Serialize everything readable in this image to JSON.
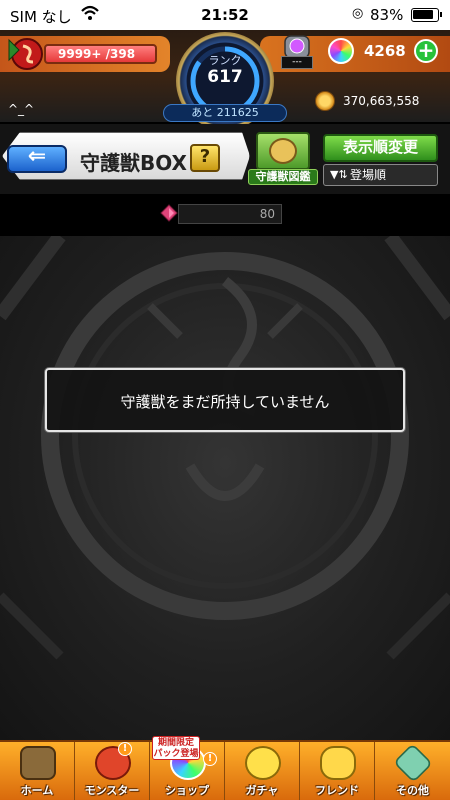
{
  "status_bar": {
    "carrier": "SIM なし",
    "time": "21:52",
    "battery_percent": "83%"
  },
  "header": {
    "stamina_current": "9999+",
    "stamina_max": "/398",
    "stamina_fill": 1.0,
    "rank_label": "ランク",
    "rank_value": "617",
    "rank_progress": 0.85,
    "next_rank": "あと 211625",
    "bank_value": "---",
    "orb_count": "4268",
    "gold_count": "370,663,558",
    "emote": "^_^"
  },
  "titlebar": {
    "back_arrow": "⇐",
    "title": "守護獣BOX",
    "help": "?",
    "zukan_label": "守護獣図鑑",
    "sort_button": "表示順変更",
    "sort_order": "登場順"
  },
  "count": "80",
  "content": {
    "empty_message": "守護獣をまだ所持していません"
  },
  "bottom_nav": {
    "items": [
      {
        "label": "ホーム",
        "icon": "home-icon"
      },
      {
        "label": "モンスター",
        "icon": "monster-icon"
      },
      {
        "label": "ショップ",
        "icon": "shop-icon"
      },
      {
        "label": "ガチャ",
        "icon": "gacha-icon"
      },
      {
        "label": "フレンド",
        "icon": "friend-icon"
      },
      {
        "label": "その他",
        "icon": "other-icon"
      }
    ],
    "limited_badge": "期間限定 パック登場",
    "notice": "!"
  },
  "colors": {
    "accent_orange": "#e3842a",
    "nav_orange": "#ffb02a",
    "green_button": "#2f8f1c",
    "blue_back": "#1c62cc"
  }
}
